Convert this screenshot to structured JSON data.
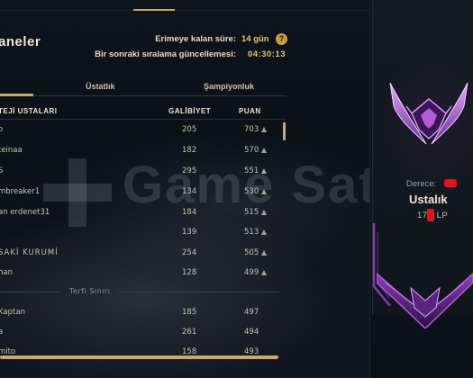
{
  "top_nav": {
    "tabs": [
      "",
      "",
      "",
      ""
    ],
    "active_index": 2
  },
  "header": {
    "title": "aneler",
    "decay_label": "Erimeye kalan süre:",
    "decay_value": "14 gün",
    "update_label": "Bir sonraki sıralama güncellemesi:",
    "update_value": "04:30:13",
    "info_icon": "?"
  },
  "tabs": [
    {
      "label": "Üstatlık"
    },
    {
      "label": "Şampiyonluk"
    }
  ],
  "table": {
    "columns": {
      "name": "TEJİ USTALARI",
      "wins": "GALİBİYET",
      "points": "PUAN"
    },
    "rows": [
      {
        "name": "o",
        "wins": "205",
        "points": "703"
      },
      {
        "name": "teinaa",
        "wins": "182",
        "points": "570"
      },
      {
        "name": "S",
        "wins": "295",
        "points": "551"
      },
      {
        "name": "mbreaker1",
        "wins": "134",
        "points": "530"
      },
      {
        "name": "an erdenet31",
        "wins": "184",
        "points": "515"
      },
      {
        "name": "",
        "wins": "139",
        "points": "513"
      },
      {
        "name": "SAKİ KURUMİ",
        "wins": "254",
        "points": "505"
      },
      {
        "name": "han",
        "wins": "128",
        "points": "499"
      }
    ],
    "promotion_label": "Terfi Sınırı",
    "rows_below": [
      {
        "name": "Kaptan",
        "wins": "185",
        "points": "497"
      },
      {
        "name": "a",
        "wins": "261",
        "points": "494"
      },
      {
        "name": "mito",
        "wins": "158",
        "points": "493"
      }
    ],
    "trend_icon": "triangle-up-icon"
  },
  "watermark": {
    "text": "Game Satış"
  },
  "rank_card": {
    "tier_label": "Derece:",
    "rank_name": "Ustalık",
    "lp_prefix": "17",
    "lp_suffix": "LP",
    "emblem_icon": "master-emblem-icon"
  },
  "colors": {
    "accent_gold": "#c8aa6e",
    "value_gold": "#e8c667",
    "redaction_red": "#e0141c",
    "emblem_purple": "#b45cd6"
  }
}
